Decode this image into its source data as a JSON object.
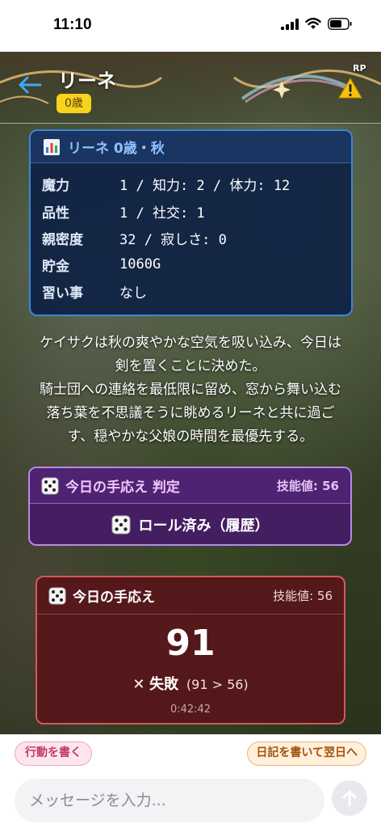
{
  "status_bar": {
    "time": "11:10"
  },
  "header": {
    "name": "リーネ",
    "age_badge": "0歳",
    "rp_label": "RP"
  },
  "status_panel": {
    "title": "リーネ 0歳・秋",
    "rows": [
      {
        "label": "魔力",
        "value": "1 / 知力: 2 / 体力: 12"
      },
      {
        "label": "品性",
        "value": "1 / 社交: 1"
      },
      {
        "label": "親密度",
        "value": "32 / 寂しさ: 0"
      },
      {
        "label": "貯金",
        "value": "1060G"
      },
      {
        "label": "習い事",
        "value": "なし"
      }
    ]
  },
  "narrative": {
    "lines": [
      "ケイサクは秋の爽やかな空気を吸い込み、今日は",
      "剣を置くことに決めた。",
      "騎士団への連絡を最低限に留め、窓から舞い込む",
      "落ち葉を不思議そうに眺めるリーネと共に過ご",
      "す、穏やかな父娘の時間を最優先する。"
    ]
  },
  "roll_panel": {
    "title": "今日の手応え 判定",
    "skill": "技能値: 56",
    "button_label": "ロール済み（履歴）"
  },
  "result_panel": {
    "title": "今日の手応え",
    "skill": "技能値: 56",
    "roll_value": "91",
    "verdict_mark": "✕",
    "verdict_label": "失敗",
    "verdict_detail": "(91 > 56)",
    "time": "0:42:42"
  },
  "bottom": {
    "action_button": "行動を書く",
    "diary_button": "日記を書いて翌日へ",
    "input_placeholder": "メッセージを入力..."
  },
  "colors": {
    "status_panel_border": "#3b86d8",
    "roll_panel_border": "#b98ae6",
    "result_panel_border": "#d15a5a",
    "age_badge": "#f7d21e"
  },
  "icons": [
    "back-arrow-icon",
    "warning-icon",
    "chart-icon",
    "dice-icon",
    "send-arrow-icon",
    "cellular-icon",
    "wifi-icon",
    "battery-icon"
  ]
}
